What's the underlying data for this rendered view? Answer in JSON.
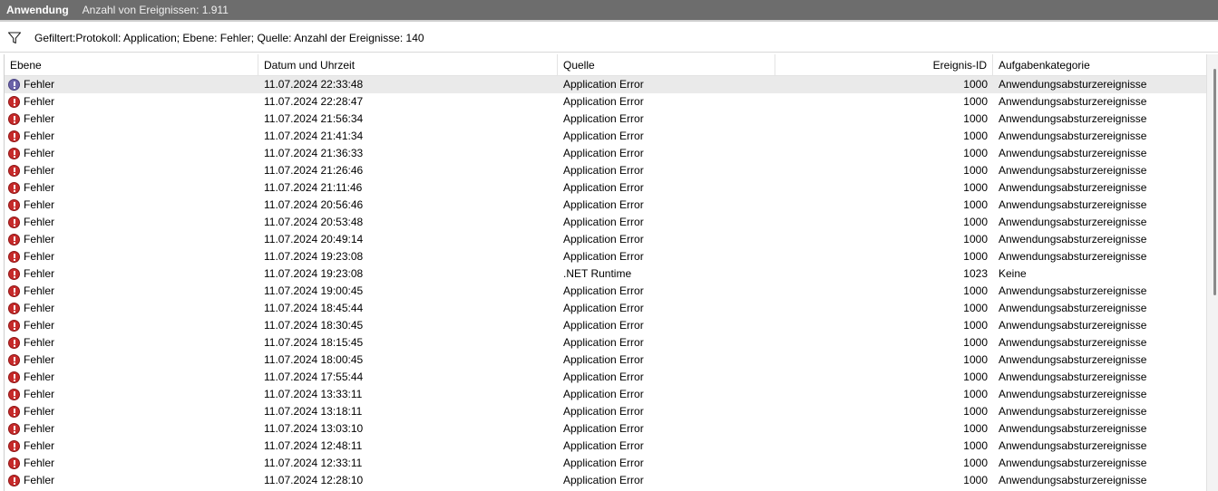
{
  "titlebar": {
    "app_name": "Anwendung",
    "event_count": "Anzahl von Ereignissen: 1.911"
  },
  "filter": {
    "icon": "filter-icon",
    "text": "Gefiltert:Protokoll: Application; Ebene: Fehler; Quelle:  Anzahl der Ereignisse: 140"
  },
  "columns": [
    "Ebene",
    "Datum und Uhrzeit",
    "Quelle",
    "Ereignis-ID",
    "Aufgabenkategorie"
  ],
  "colors": {
    "error": "#c62a2a",
    "selected_row": "#eaeaea",
    "titlebar": "#6d6d6d"
  },
  "rows": [
    {
      "level": "Fehler",
      "datetime": "11.07.2024 22:33:48",
      "source": "Application Error",
      "id": "1000",
      "category": "Anwendungsabsturzereignisse"
    },
    {
      "level": "Fehler",
      "datetime": "11.07.2024 22:28:47",
      "source": "Application Error",
      "id": "1000",
      "category": "Anwendungsabsturzereignisse"
    },
    {
      "level": "Fehler",
      "datetime": "11.07.2024 21:56:34",
      "source": "Application Error",
      "id": "1000",
      "category": "Anwendungsabsturzereignisse"
    },
    {
      "level": "Fehler",
      "datetime": "11.07.2024 21:41:34",
      "source": "Application Error",
      "id": "1000",
      "category": "Anwendungsabsturzereignisse"
    },
    {
      "level": "Fehler",
      "datetime": "11.07.2024 21:36:33",
      "source": "Application Error",
      "id": "1000",
      "category": "Anwendungsabsturzereignisse"
    },
    {
      "level": "Fehler",
      "datetime": "11.07.2024 21:26:46",
      "source": "Application Error",
      "id": "1000",
      "category": "Anwendungsabsturzereignisse"
    },
    {
      "level": "Fehler",
      "datetime": "11.07.2024 21:11:46",
      "source": "Application Error",
      "id": "1000",
      "category": "Anwendungsabsturzereignisse"
    },
    {
      "level": "Fehler",
      "datetime": "11.07.2024 20:56:46",
      "source": "Application Error",
      "id": "1000",
      "category": "Anwendungsabsturzereignisse"
    },
    {
      "level": "Fehler",
      "datetime": "11.07.2024 20:53:48",
      "source": "Application Error",
      "id": "1000",
      "category": "Anwendungsabsturzereignisse"
    },
    {
      "level": "Fehler",
      "datetime": "11.07.2024 20:49:14",
      "source": "Application Error",
      "id": "1000",
      "category": "Anwendungsabsturzereignisse"
    },
    {
      "level": "Fehler",
      "datetime": "11.07.2024 19:23:08",
      "source": "Application Error",
      "id": "1000",
      "category": "Anwendungsabsturzereignisse"
    },
    {
      "level": "Fehler",
      "datetime": "11.07.2024 19:23:08",
      "source": ".NET Runtime",
      "id": "1023",
      "category": "Keine"
    },
    {
      "level": "Fehler",
      "datetime": "11.07.2024 19:00:45",
      "source": "Application Error",
      "id": "1000",
      "category": "Anwendungsabsturzereignisse"
    },
    {
      "level": "Fehler",
      "datetime": "11.07.2024 18:45:44",
      "source": "Application Error",
      "id": "1000",
      "category": "Anwendungsabsturzereignisse"
    },
    {
      "level": "Fehler",
      "datetime": "11.07.2024 18:30:45",
      "source": "Application Error",
      "id": "1000",
      "category": "Anwendungsabsturzereignisse"
    },
    {
      "level": "Fehler",
      "datetime": "11.07.2024 18:15:45",
      "source": "Application Error",
      "id": "1000",
      "category": "Anwendungsabsturzereignisse"
    },
    {
      "level": "Fehler",
      "datetime": "11.07.2024 18:00:45",
      "source": "Application Error",
      "id": "1000",
      "category": "Anwendungsabsturzereignisse"
    },
    {
      "level": "Fehler",
      "datetime": "11.07.2024 17:55:44",
      "source": "Application Error",
      "id": "1000",
      "category": "Anwendungsabsturzereignisse"
    },
    {
      "level": "Fehler",
      "datetime": "11.07.2024 13:33:11",
      "source": "Application Error",
      "id": "1000",
      "category": "Anwendungsabsturzereignisse"
    },
    {
      "level": "Fehler",
      "datetime": "11.07.2024 13:18:11",
      "source": "Application Error",
      "id": "1000",
      "category": "Anwendungsabsturzereignisse"
    },
    {
      "level": "Fehler",
      "datetime": "11.07.2024 13:03:10",
      "source": "Application Error",
      "id": "1000",
      "category": "Anwendungsabsturzereignisse"
    },
    {
      "level": "Fehler",
      "datetime": "11.07.2024 12:48:11",
      "source": "Application Error",
      "id": "1000",
      "category": "Anwendungsabsturzereignisse"
    },
    {
      "level": "Fehler",
      "datetime": "11.07.2024 12:33:11",
      "source": "Application Error",
      "id": "1000",
      "category": "Anwendungsabsturzereignisse"
    },
    {
      "level": "Fehler",
      "datetime": "11.07.2024 12:28:10",
      "source": "Application Error",
      "id": "1000",
      "category": "Anwendungsabsturzereignisse"
    }
  ]
}
